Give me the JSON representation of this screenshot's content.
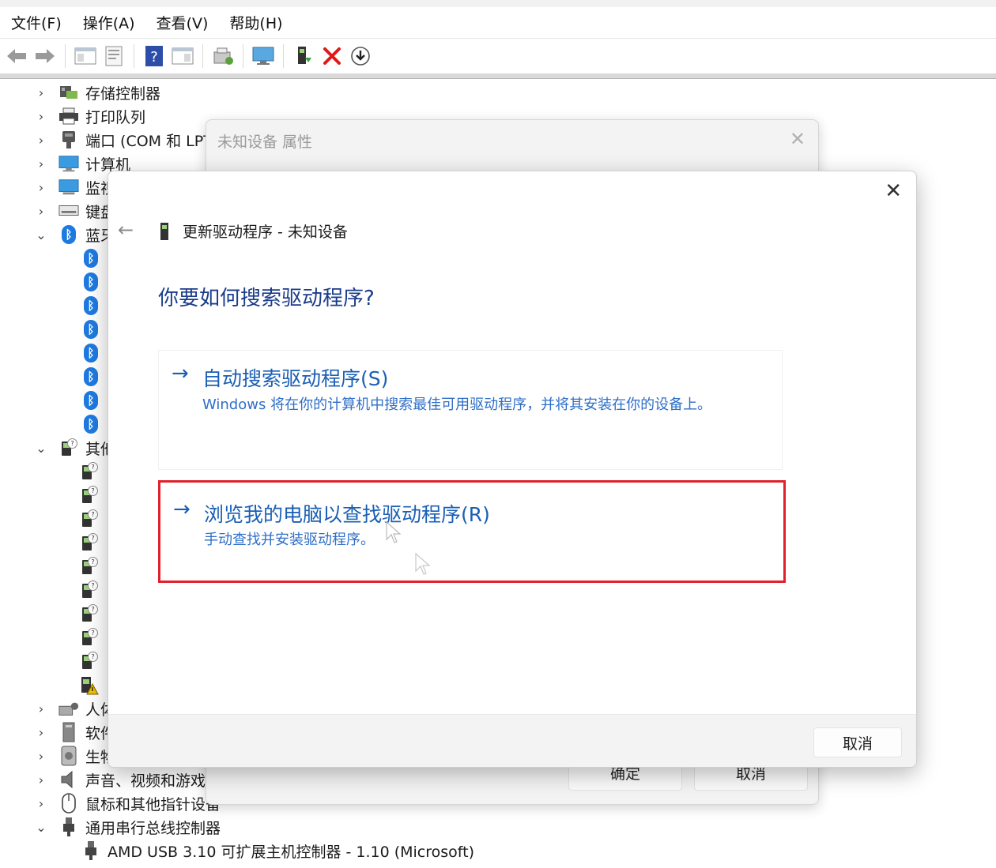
{
  "menubar": {
    "items": [
      "文件(F)",
      "操作(A)",
      "查看(V)",
      "帮助(H)"
    ]
  },
  "toolbar": {
    "buttons": [
      "back-icon",
      "forward-icon",
      "show-hide-tree-icon",
      "properties-icon",
      "help-icon",
      "action-pane-icon",
      "scan-hardware-icon",
      "monitor-icon",
      "update-driver-icon",
      "uninstall-icon",
      "download-icon"
    ]
  },
  "tree": {
    "storage_controllers": "存储控制器",
    "print_queues": "打印队列",
    "ports": "端口 (COM 和 LPT",
    "computer": "计算机",
    "monitors": "监视",
    "keyboards": "键盘",
    "bluetooth": "蓝牙",
    "other_devices": "其他",
    "hid": "人体",
    "software": "软件",
    "biometric": "生物",
    "sound": "声音、视频和游戏",
    "mice": "鼠标和其他指针设备",
    "usb_controllers": "通用串行总线控制器",
    "usb_child": "AMD USB 3.10 可扩展主机控制器 - 1.10 (Microsoft)"
  },
  "props_dialog": {
    "title": "未知设备 属性",
    "ok_label": "确定",
    "cancel_label": "取消"
  },
  "wizard": {
    "header_title": "更新驱动程序 - 未知设备",
    "question": "你要如何搜索驱动程序?",
    "option_auto": {
      "title": "自动搜索驱动程序(S)",
      "desc": "Windows 将在你的计算机中搜索最佳可用驱动程序，并将其安装在你的设备上。"
    },
    "option_browse": {
      "title": "浏览我的电脑以查找驱动程序(R)",
      "desc": "手动查找并安装驱动程序。"
    },
    "cancel_label": "取消"
  },
  "colors": {
    "accent_blue": "#1a5fb4",
    "highlight_red": "#e0202a",
    "bluetooth_blue": "#1f7ae0"
  }
}
